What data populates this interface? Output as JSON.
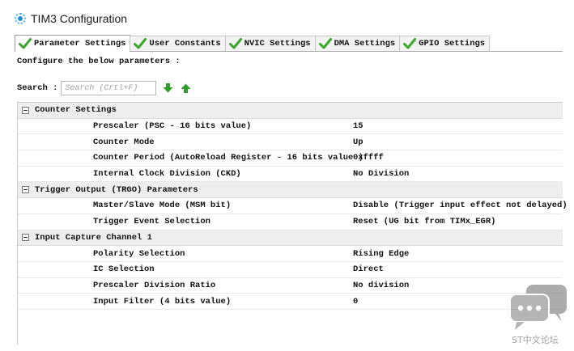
{
  "window": {
    "title": "TIM3 Configuration"
  },
  "tabs": [
    {
      "label": "Parameter Settings",
      "active": true
    },
    {
      "label": "User Constants",
      "active": false
    },
    {
      "label": "NVIC Settings",
      "active": false
    },
    {
      "label": "DMA Settings",
      "active": false
    },
    {
      "label": "GPIO Settings",
      "active": false
    }
  ],
  "instructions": "Configure the below parameters :",
  "search": {
    "label": "Search :",
    "placeholder": "Search (Crtl+F)"
  },
  "groups": [
    {
      "title": "Counter Settings",
      "params": [
        {
          "name": "Prescaler (PSC - 16 bits value)",
          "value": "15"
        },
        {
          "name": "Counter Mode",
          "value": "Up"
        },
        {
          "name": "Counter Period (AutoReload Register - 16 bits value )",
          "value": "0xffff"
        },
        {
          "name": "Internal Clock Division (CKD)",
          "value": "No Division"
        }
      ]
    },
    {
      "title": "Trigger Output (TRGO) Parameters",
      "params": [
        {
          "name": "Master/Slave Mode (MSM bit)",
          "value": "Disable (Trigger input effect not delayed)"
        },
        {
          "name": "Trigger Event Selection",
          "value": "Reset (UG bit from TIMx_EGR)"
        }
      ]
    },
    {
      "title": "Input Capture Channel 1",
      "params": [
        {
          "name": "Polarity Selection",
          "value": "Rising Edge"
        },
        {
          "name": "IC Selection",
          "value": "Direct"
        },
        {
          "name": "Prescaler Division Ratio",
          "value": "No division"
        },
        {
          "name": "Input Filter (4 bits value)",
          "value": "0"
        }
      ]
    }
  ],
  "watermark": {
    "text": "ST中文论坛"
  },
  "colors": {
    "check_green": "#3aa62a",
    "arrow_green": "#2e9e2a",
    "group_bg": "#eeeeee",
    "accent_blue": "#1f8fd6"
  }
}
